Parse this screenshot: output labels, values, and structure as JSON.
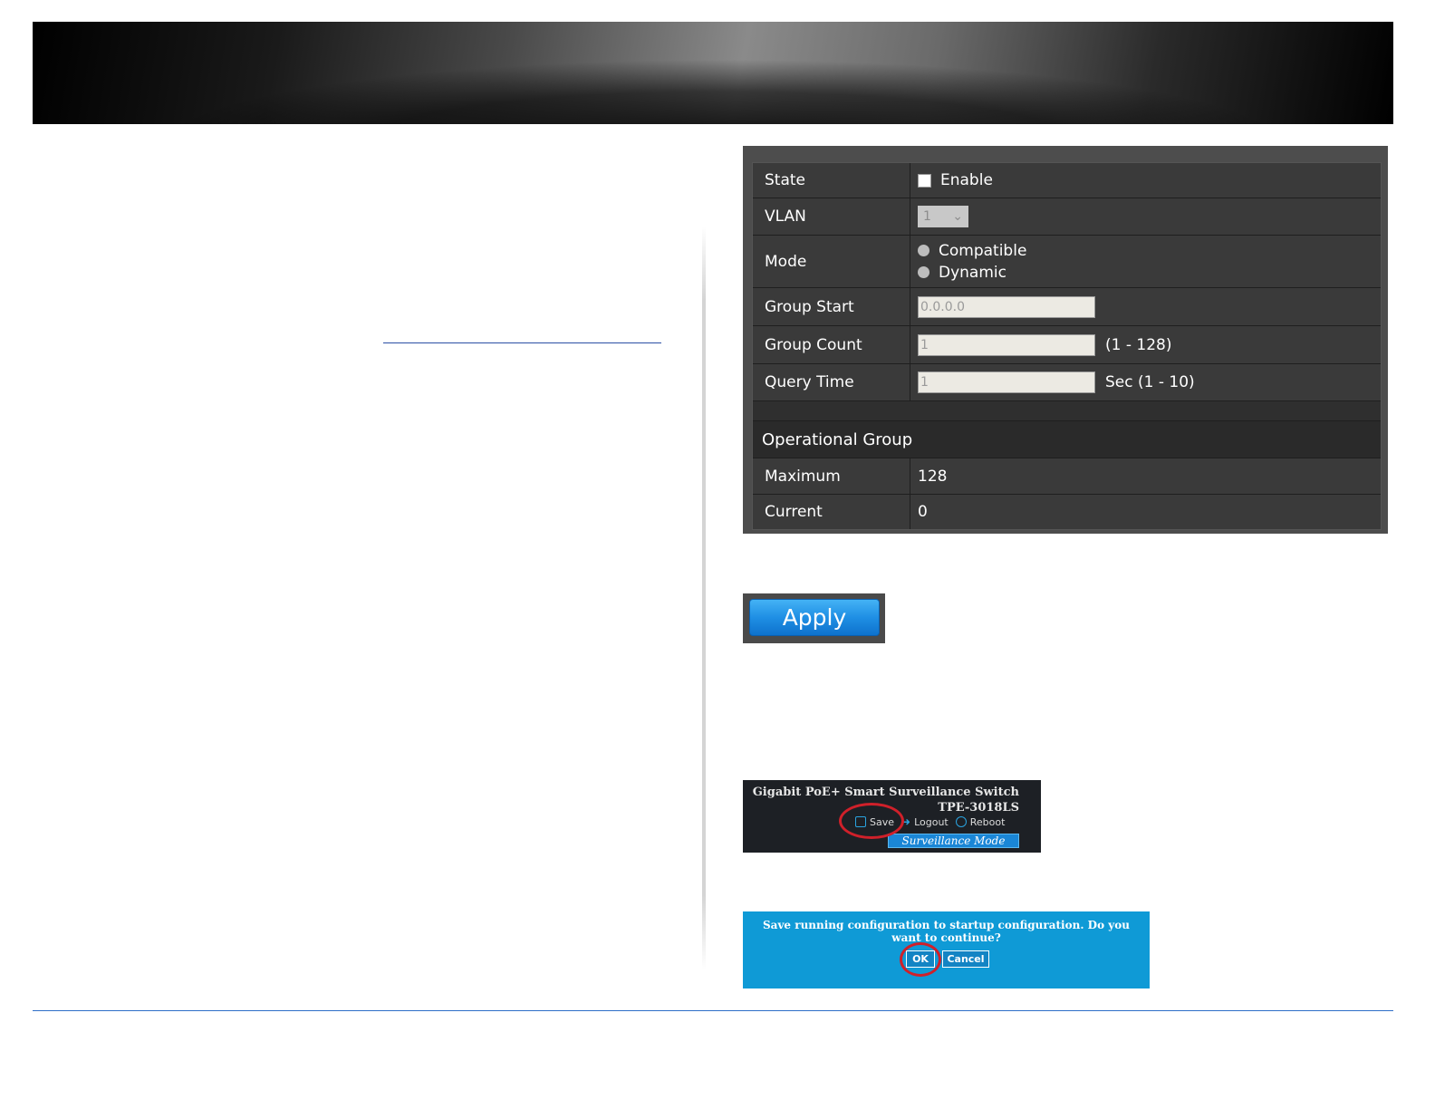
{
  "config": {
    "state_label": "State",
    "state_enable": "Enable",
    "vlan_label": "VLAN",
    "vlan_value": "1",
    "mode_label": "Mode",
    "mode_opt1": "Compatible",
    "mode_opt2": "Dynamic",
    "group_start_label": "Group Start",
    "group_start_value": "0.0.0.0",
    "group_count_label": "Group Count",
    "group_count_value": "1",
    "group_count_range": "(1 - 128)",
    "query_time_label": "Query Time",
    "query_time_value": "1",
    "query_time_range": "Sec (1 - 10)"
  },
  "operational": {
    "title": "Operational Group",
    "max_label": "Maximum",
    "max_value": "128",
    "cur_label": "Current",
    "cur_value": "0"
  },
  "apply": {
    "label": "Apply"
  },
  "save_header": {
    "title1": "Gigabit PoE+ Smart Surveillance Switch",
    "title2": "TPE-3018LS",
    "save": "Save",
    "logout": "Logout",
    "reboot": "Reboot",
    "surveillance": "Surveillance Mode"
  },
  "confirm": {
    "message": "Save running configuration to startup configuration. Do you want to continue?",
    "ok": "OK",
    "cancel": "Cancel"
  },
  "colors": {
    "accent_blue": "#1f8fe4",
    "highlight_red": "#d0202a",
    "panel_gray": "#4d4d4d"
  }
}
